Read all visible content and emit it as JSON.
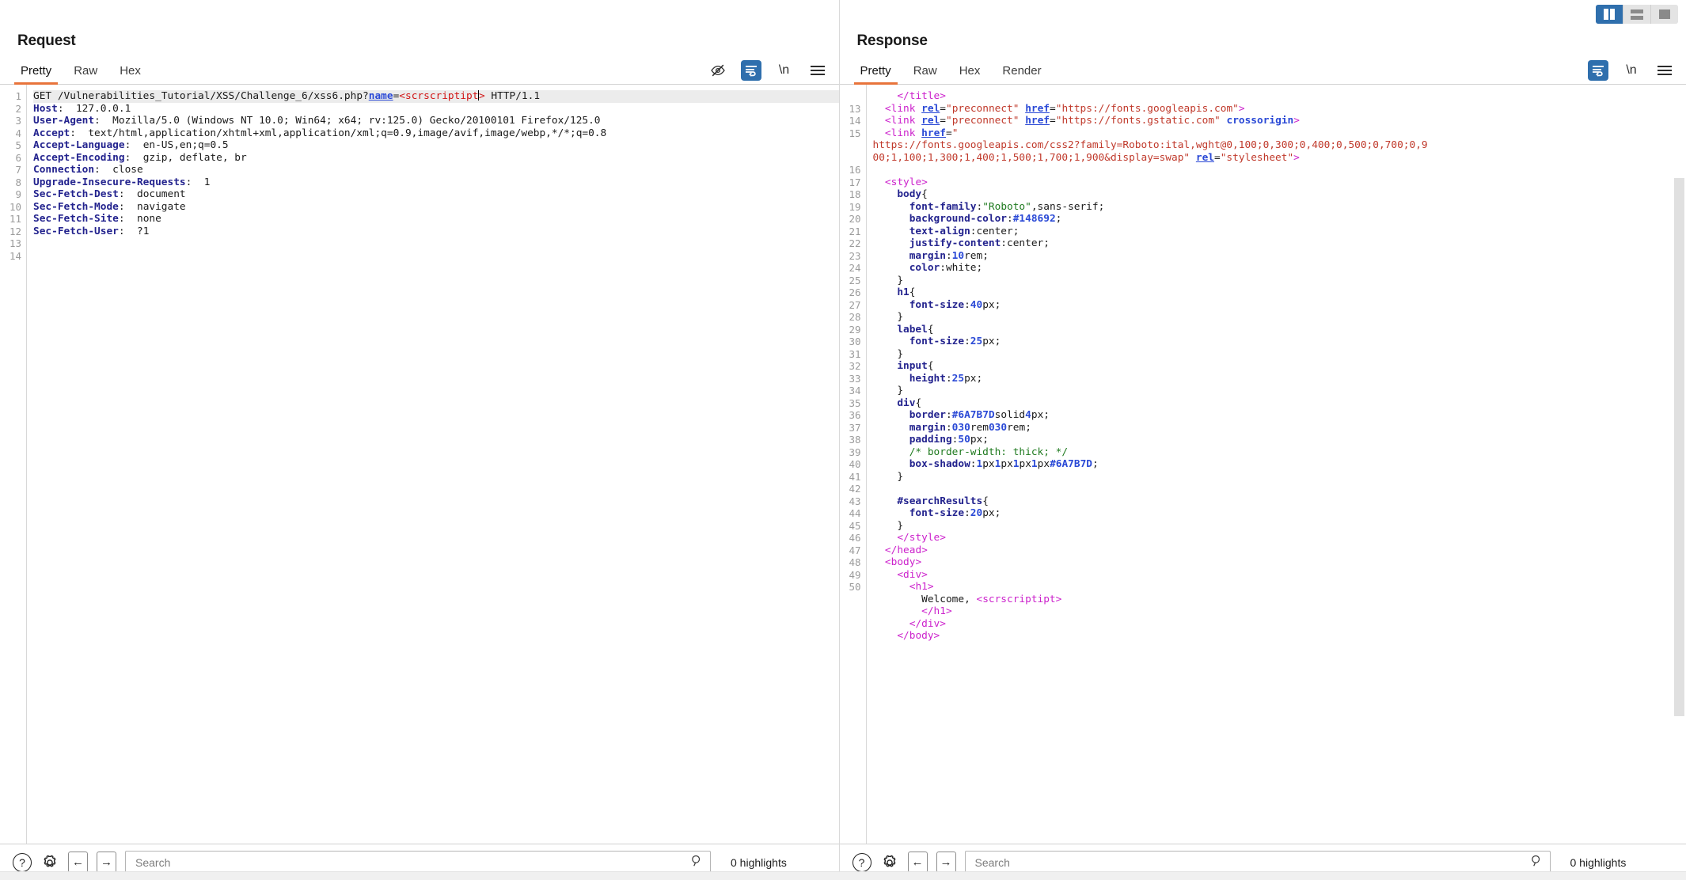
{
  "layout_toggles": [
    {
      "name": "side-by-side",
      "label": "",
      "active": true
    },
    {
      "name": "stacked",
      "label": "",
      "active": false
    },
    {
      "name": "single",
      "label": "",
      "active": false
    }
  ],
  "request": {
    "title": "Request",
    "tabs": [
      {
        "label": "Pretty",
        "active": true
      },
      {
        "label": "Raw",
        "active": false
      },
      {
        "label": "Hex",
        "active": false
      }
    ],
    "toolbar": {
      "eye_off": "eye-off-icon",
      "word_wrap": "word-wrap-icon",
      "newline": "\\n",
      "menu": "hamburger-icon"
    },
    "line_numbers": [
      "1",
      "2",
      "3",
      "4",
      "5",
      "6",
      "7",
      "8",
      "9",
      "10",
      "11",
      "12",
      "13",
      "14"
    ],
    "lines": [
      {
        "n": 1,
        "highlight": true,
        "tokens": [
          {
            "t": "GET /Vulnerabilities_Tutorial/XSS/Challenge_6/xss6.php?",
            "c": "k-plain"
          },
          {
            "t": "name",
            "c": "k-param"
          },
          {
            "t": "=",
            "c": "k-plain"
          },
          {
            "t": "<scrscriptipt",
            "c": "k-xss"
          },
          {
            "t": "CARET",
            "c": "caret"
          },
          {
            "t": ">",
            "c": "k-xss"
          },
          {
            "t": " HTTP/1.1",
            "c": "k-plain"
          }
        ]
      },
      {
        "n": 2,
        "tokens": [
          {
            "t": "Host",
            "c": "k-hdr"
          },
          {
            "t": ":  127.0.0.1",
            "c": "k-plain"
          }
        ]
      },
      {
        "n": 3,
        "tokens": [
          {
            "t": "User-Agent",
            "c": "k-hdr"
          },
          {
            "t": ":  Mozilla/5.0 (Windows NT 10.0; Win64; x64; rv:125.0) Gecko/20100101 Firefox/125.0",
            "c": "k-plain"
          }
        ]
      },
      {
        "n": 4,
        "tokens": [
          {
            "t": "Accept",
            "c": "k-hdr"
          },
          {
            "t": ":  text/html,application/xhtml+xml,application/xml;q=0.9,image/avif,image/webp,*/*;q=0.8",
            "c": "k-plain"
          }
        ]
      },
      {
        "n": 5,
        "tokens": [
          {
            "t": "Accept-Language",
            "c": "k-hdr"
          },
          {
            "t": ":  en-US,en;q=0.5",
            "c": "k-plain"
          }
        ]
      },
      {
        "n": 6,
        "tokens": [
          {
            "t": "Accept-Encoding",
            "c": "k-hdr"
          },
          {
            "t": ":  gzip, deflate, br",
            "c": "k-plain"
          }
        ]
      },
      {
        "n": 7,
        "tokens": [
          {
            "t": "Connection",
            "c": "k-hdr"
          },
          {
            "t": ":  close",
            "c": "k-plain"
          }
        ]
      },
      {
        "n": 8,
        "tokens": [
          {
            "t": "Upgrade-Insecure-Requests",
            "c": "k-hdr"
          },
          {
            "t": ":  1",
            "c": "k-plain"
          }
        ]
      },
      {
        "n": 9,
        "tokens": [
          {
            "t": "Sec-Fetch-Dest",
            "c": "k-hdr"
          },
          {
            "t": ":  document",
            "c": "k-plain"
          }
        ]
      },
      {
        "n": 10,
        "tokens": [
          {
            "t": "Sec-Fetch-Mode",
            "c": "k-hdr"
          },
          {
            "t": ":  navigate",
            "c": "k-plain"
          }
        ]
      },
      {
        "n": 11,
        "tokens": [
          {
            "t": "Sec-Fetch-Site",
            "c": "k-hdr"
          },
          {
            "t": ":  none",
            "c": "k-plain"
          }
        ]
      },
      {
        "n": 12,
        "tokens": [
          {
            "t": "Sec-Fetch-User",
            "c": "k-hdr"
          },
          {
            "t": ":  ?1",
            "c": "k-plain"
          }
        ]
      },
      {
        "n": 13,
        "tokens": []
      },
      {
        "n": 14,
        "tokens": []
      }
    ],
    "bottom": {
      "help": "?",
      "settings": "gear-icon",
      "back": "←",
      "forward": "→",
      "search_value": "",
      "search_placeholder": "Search",
      "search_icon": "search-icon",
      "highlights": "0 highlights"
    }
  },
  "response": {
    "title": "Response",
    "tabs": [
      {
        "label": "Pretty",
        "active": true
      },
      {
        "label": "Raw",
        "active": false
      },
      {
        "label": "Hex",
        "active": false
      },
      {
        "label": "Render",
        "active": false
      }
    ],
    "toolbar": {
      "word_wrap": "word-wrap-icon",
      "newline": "\\n",
      "menu": "hamburger-icon"
    },
    "gutter": [
      "",
      "13",
      "14",
      "15",
      "",
      "",
      "16",
      "17",
      "18",
      "19",
      "20",
      "21",
      "22",
      "23",
      "24",
      "25",
      "26",
      "27",
      "28",
      "29",
      "30",
      "31",
      "32",
      "33",
      "34",
      "35",
      "36",
      "37",
      "38",
      "39",
      "40",
      "41",
      "42",
      "43",
      "44",
      "45",
      "46",
      "47",
      "48",
      "49",
      "50",
      "",
      "",
      "",
      ""
    ],
    "lines": [
      {
        "n": "",
        "tokens": [
          {
            "t": "    ",
            "c": "k-plain"
          },
          {
            "t": "</title>",
            "c": "k-tag"
          }
        ]
      },
      {
        "n": "13",
        "tokens": [
          {
            "t": "  ",
            "c": "k-plain"
          },
          {
            "t": "<link",
            "c": "k-tag"
          },
          {
            "t": " ",
            "c": "k-plain"
          },
          {
            "t": "rel",
            "c": "k-attru"
          },
          {
            "t": "=",
            "c": "k-plain"
          },
          {
            "t": "\"preconnect\"",
            "c": "k-str"
          },
          {
            "t": " ",
            "c": "k-plain"
          },
          {
            "t": "href",
            "c": "k-attru"
          },
          {
            "t": "=",
            "c": "k-plain"
          },
          {
            "t": "\"https://fonts.googleapis.com\"",
            "c": "k-str"
          },
          {
            "t": ">",
            "c": "k-tag"
          }
        ]
      },
      {
        "n": "14",
        "tokens": [
          {
            "t": "  ",
            "c": "k-plain"
          },
          {
            "t": "<link",
            "c": "k-tag"
          },
          {
            "t": " ",
            "c": "k-plain"
          },
          {
            "t": "rel",
            "c": "k-attru"
          },
          {
            "t": "=",
            "c": "k-plain"
          },
          {
            "t": "\"preconnect\"",
            "c": "k-str"
          },
          {
            "t": " ",
            "c": "k-plain"
          },
          {
            "t": "href",
            "c": "k-attru"
          },
          {
            "t": "=",
            "c": "k-plain"
          },
          {
            "t": "\"https://fonts.gstatic.com\"",
            "c": "k-str"
          },
          {
            "t": " ",
            "c": "k-plain"
          },
          {
            "t": "crossorigin",
            "c": "k-attr"
          },
          {
            "t": ">",
            "c": "k-tag"
          }
        ]
      },
      {
        "n": "15",
        "tokens": [
          {
            "t": "  ",
            "c": "k-plain"
          },
          {
            "t": "<link",
            "c": "k-tag"
          },
          {
            "t": " ",
            "c": "k-plain"
          },
          {
            "t": "href",
            "c": "k-attru"
          },
          {
            "t": "=",
            "c": "k-plain"
          },
          {
            "t": "\"",
            "c": "k-str"
          }
        ]
      },
      {
        "n": "",
        "tokens": [
          {
            "t": "https://fonts.googleapis.com/css2?family=Roboto:ital,wght@0,100;0,300;0,400;0,500;0,700;0,9",
            "c": "k-str"
          }
        ]
      },
      {
        "n": "",
        "tokens": [
          {
            "t": "00;1,100;1,300;1,400;1,500;1,700;1,900&display=swap\"",
            "c": "k-str"
          },
          {
            "t": " ",
            "c": "k-plain"
          },
          {
            "t": "rel",
            "c": "k-attru"
          },
          {
            "t": "=",
            "c": "k-plain"
          },
          {
            "t": "\"stylesheet\"",
            "c": "k-str"
          },
          {
            "t": ">",
            "c": "k-tag"
          }
        ]
      },
      {
        "n": "16",
        "tokens": []
      },
      {
        "n": "17",
        "tokens": [
          {
            "t": "  ",
            "c": "k-plain"
          },
          {
            "t": "<style>",
            "c": "k-tag"
          }
        ]
      },
      {
        "n": "18",
        "tokens": [
          {
            "t": "    body",
            "c": "k-prop"
          },
          {
            "t": "{",
            "c": "k-plain"
          }
        ]
      },
      {
        "n": "19",
        "tokens": [
          {
            "t": "      font-family",
            "c": "k-prop"
          },
          {
            "t": ":",
            "c": "k-plain"
          },
          {
            "t": "\"Roboto\"",
            "c": "k-grn"
          },
          {
            "t": ",sans-serif;",
            "c": "k-plain"
          }
        ]
      },
      {
        "n": "20",
        "tokens": [
          {
            "t": "      background-color",
            "c": "k-prop"
          },
          {
            "t": ":",
            "c": "k-plain"
          },
          {
            "t": "#148692",
            "c": "k-num"
          },
          {
            "t": ";",
            "c": "k-plain"
          }
        ]
      },
      {
        "n": "21",
        "tokens": [
          {
            "t": "      text-align",
            "c": "k-prop"
          },
          {
            "t": ":center;",
            "c": "k-plain"
          }
        ]
      },
      {
        "n": "22",
        "tokens": [
          {
            "t": "      justify-content",
            "c": "k-prop"
          },
          {
            "t": ":center;",
            "c": "k-plain"
          }
        ]
      },
      {
        "n": "23",
        "tokens": [
          {
            "t": "      margin",
            "c": "k-prop"
          },
          {
            "t": ":",
            "c": "k-plain"
          },
          {
            "t": "10",
            "c": "k-num"
          },
          {
            "t": "rem;",
            "c": "k-plain"
          }
        ]
      },
      {
        "n": "24",
        "tokens": [
          {
            "t": "      color",
            "c": "k-prop"
          },
          {
            "t": ":white;",
            "c": "k-plain"
          }
        ]
      },
      {
        "n": "25",
        "tokens": [
          {
            "t": "    }",
            "c": "k-plain"
          }
        ]
      },
      {
        "n": "26",
        "tokens": [
          {
            "t": "    h1",
            "c": "k-prop"
          },
          {
            "t": "{",
            "c": "k-plain"
          }
        ]
      },
      {
        "n": "27",
        "tokens": [
          {
            "t": "      font-size",
            "c": "k-prop"
          },
          {
            "t": ":",
            "c": "k-plain"
          },
          {
            "t": "40",
            "c": "k-num"
          },
          {
            "t": "px;",
            "c": "k-plain"
          }
        ]
      },
      {
        "n": "28",
        "tokens": [
          {
            "t": "    }",
            "c": "k-plain"
          }
        ]
      },
      {
        "n": "29",
        "tokens": [
          {
            "t": "    label",
            "c": "k-prop"
          },
          {
            "t": "{",
            "c": "k-plain"
          }
        ]
      },
      {
        "n": "30",
        "tokens": [
          {
            "t": "      font-size",
            "c": "k-prop"
          },
          {
            "t": ":",
            "c": "k-plain"
          },
          {
            "t": "25",
            "c": "k-num"
          },
          {
            "t": "px;",
            "c": "k-plain"
          }
        ]
      },
      {
        "n": "31",
        "tokens": [
          {
            "t": "    }",
            "c": "k-plain"
          }
        ]
      },
      {
        "n": "32",
        "tokens": [
          {
            "t": "    input",
            "c": "k-prop"
          },
          {
            "t": "{",
            "c": "k-plain"
          }
        ]
      },
      {
        "n": "33",
        "tokens": [
          {
            "t": "      height",
            "c": "k-prop"
          },
          {
            "t": ":",
            "c": "k-plain"
          },
          {
            "t": "25",
            "c": "k-num"
          },
          {
            "t": "px;",
            "c": "k-plain"
          }
        ]
      },
      {
        "n": "34",
        "tokens": [
          {
            "t": "    }",
            "c": "k-plain"
          }
        ]
      },
      {
        "n": "35",
        "tokens": [
          {
            "t": "    div",
            "c": "k-prop"
          },
          {
            "t": "{",
            "c": "k-plain"
          }
        ]
      },
      {
        "n": "36",
        "tokens": [
          {
            "t": "      border",
            "c": "k-prop"
          },
          {
            "t": ":",
            "c": "k-plain"
          },
          {
            "t": "#6A7B7D",
            "c": "k-num"
          },
          {
            "t": "solid",
            "c": "k-plain"
          },
          {
            "t": "4",
            "c": "k-num"
          },
          {
            "t": "px;",
            "c": "k-plain"
          }
        ]
      },
      {
        "n": "37",
        "tokens": [
          {
            "t": "      margin",
            "c": "k-prop"
          },
          {
            "t": ":",
            "c": "k-plain"
          },
          {
            "t": "0",
            "c": "k-num"
          },
          {
            "t": "30",
            "c": "k-num"
          },
          {
            "t": "rem",
            "c": "k-plain"
          },
          {
            "t": "0",
            "c": "k-num"
          },
          {
            "t": "30",
            "c": "k-num"
          },
          {
            "t": "rem;",
            "c": "k-plain"
          }
        ]
      },
      {
        "n": "38",
        "tokens": [
          {
            "t": "      padding",
            "c": "k-prop"
          },
          {
            "t": ":",
            "c": "k-plain"
          },
          {
            "t": "50",
            "c": "k-num"
          },
          {
            "t": "px;",
            "c": "k-plain"
          }
        ]
      },
      {
        "n": "39",
        "tokens": [
          {
            "t": "      /* border-width: thick; */",
            "c": "k-cmt"
          }
        ]
      },
      {
        "n": "40",
        "tokens": [
          {
            "t": "      box-shadow",
            "c": "k-prop"
          },
          {
            "t": ":",
            "c": "k-plain"
          },
          {
            "t": "1",
            "c": "k-num"
          },
          {
            "t": "px",
            "c": "k-plain"
          },
          {
            "t": "1",
            "c": "k-num"
          },
          {
            "t": "px",
            "c": "k-plain"
          },
          {
            "t": "1",
            "c": "k-num"
          },
          {
            "t": "px",
            "c": "k-plain"
          },
          {
            "t": "1",
            "c": "k-num"
          },
          {
            "t": "px",
            "c": "k-plain"
          },
          {
            "t": "#6A7B7D",
            "c": "k-num"
          },
          {
            "t": ";",
            "c": "k-plain"
          }
        ]
      },
      {
        "n": "41",
        "tokens": [
          {
            "t": "    }",
            "c": "k-plain"
          }
        ]
      },
      {
        "n": "42",
        "tokens": []
      },
      {
        "n": "43",
        "tokens": [
          {
            "t": "    #searchResults",
            "c": "k-prop"
          },
          {
            "t": "{",
            "c": "k-plain"
          }
        ]
      },
      {
        "n": "44",
        "tokens": [
          {
            "t": "      font-size",
            "c": "k-prop"
          },
          {
            "t": ":",
            "c": "k-plain"
          },
          {
            "t": "20",
            "c": "k-num"
          },
          {
            "t": "px;",
            "c": "k-plain"
          }
        ]
      },
      {
        "n": "45",
        "tokens": [
          {
            "t": "    }",
            "c": "k-plain"
          }
        ]
      },
      {
        "n": "46",
        "tokens": [
          {
            "t": "    ",
            "c": "k-plain"
          },
          {
            "t": "</style>",
            "c": "k-tag"
          }
        ]
      },
      {
        "n": "47",
        "tokens": [
          {
            "t": "  ",
            "c": "k-plain"
          },
          {
            "t": "</head>",
            "c": "k-tag"
          }
        ]
      },
      {
        "n": "48",
        "tokens": [
          {
            "t": "  ",
            "c": "k-plain"
          },
          {
            "t": "<body>",
            "c": "k-tag"
          }
        ]
      },
      {
        "n": "49",
        "tokens": [
          {
            "t": "    ",
            "c": "k-plain"
          },
          {
            "t": "<div>",
            "c": "k-tag"
          }
        ]
      },
      {
        "n": "50",
        "tokens": [
          {
            "t": "      ",
            "c": "k-plain"
          },
          {
            "t": "<h1>",
            "c": "k-tag"
          }
        ]
      },
      {
        "n": "",
        "tokens": [
          {
            "t": "        Welcome, ",
            "c": "k-plain"
          },
          {
            "t": "<scrscriptipt>",
            "c": "k-tag"
          }
        ]
      },
      {
        "n": "",
        "tokens": [
          {
            "t": "        ",
            "c": "k-plain"
          },
          {
            "t": "</h1>",
            "c": "k-tag"
          }
        ]
      },
      {
        "n": "",
        "tokens": [
          {
            "t": "      ",
            "c": "k-plain"
          },
          {
            "t": "</div>",
            "c": "k-tag"
          }
        ]
      },
      {
        "n": "",
        "tokens": [
          {
            "t": "    ",
            "c": "k-plain"
          },
          {
            "t": "</body>",
            "c": "k-tag"
          }
        ]
      }
    ],
    "bottom": {
      "help": "?",
      "settings": "gear-icon",
      "back": "←",
      "forward": "→",
      "search_value": "",
      "search_placeholder": "Search",
      "search_icon": "search-icon",
      "highlights": "0 highlights"
    }
  }
}
